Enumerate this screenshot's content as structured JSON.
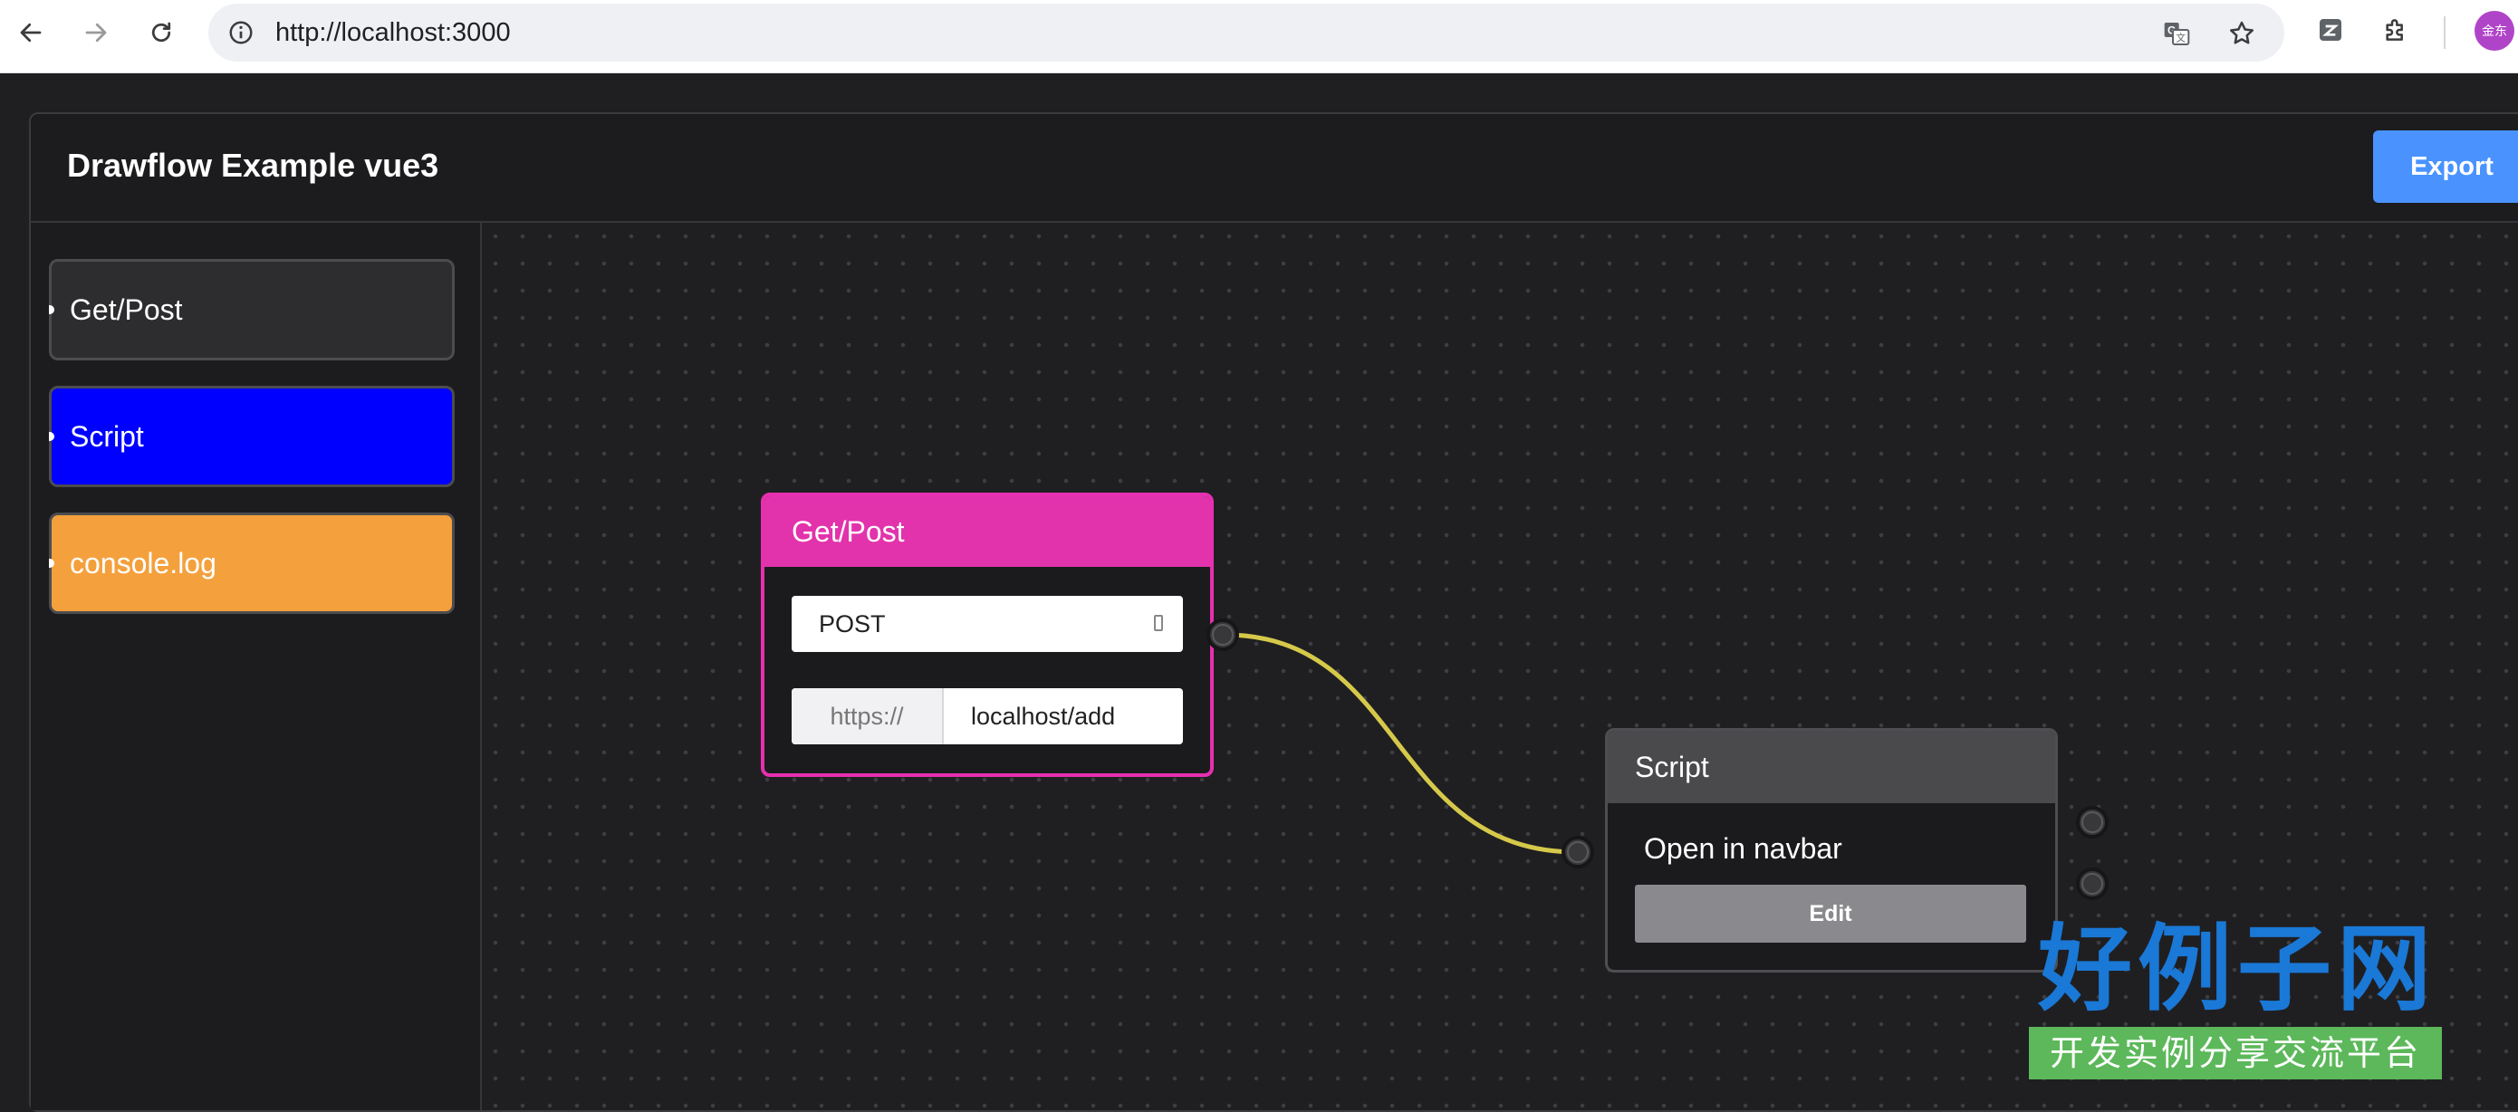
{
  "browser": {
    "url": "http://localhost:3000",
    "avatar_text": "金东"
  },
  "app": {
    "title": "Drawflow Example vue3",
    "export_label": "Export",
    "sidebar": {
      "items": [
        {
          "label": "Get/Post",
          "color": "#2d2d2f"
        },
        {
          "label": "Script",
          "color": "#0000ff"
        },
        {
          "label": "console.log",
          "color": "#f4a03c"
        }
      ]
    },
    "nodes": {
      "getpost": {
        "title": "Get/Post",
        "method": "POST",
        "url_prefix": "https://",
        "url_value": "localhost/add",
        "color": "#e233ac"
      },
      "script": {
        "title": "Script",
        "text": "Open in navbar",
        "edit_label": "Edit"
      }
    },
    "connection_color": "#d6c94a"
  },
  "watermark": {
    "title": "好例子网",
    "subtitle": "开发实例分享交流平台"
  }
}
